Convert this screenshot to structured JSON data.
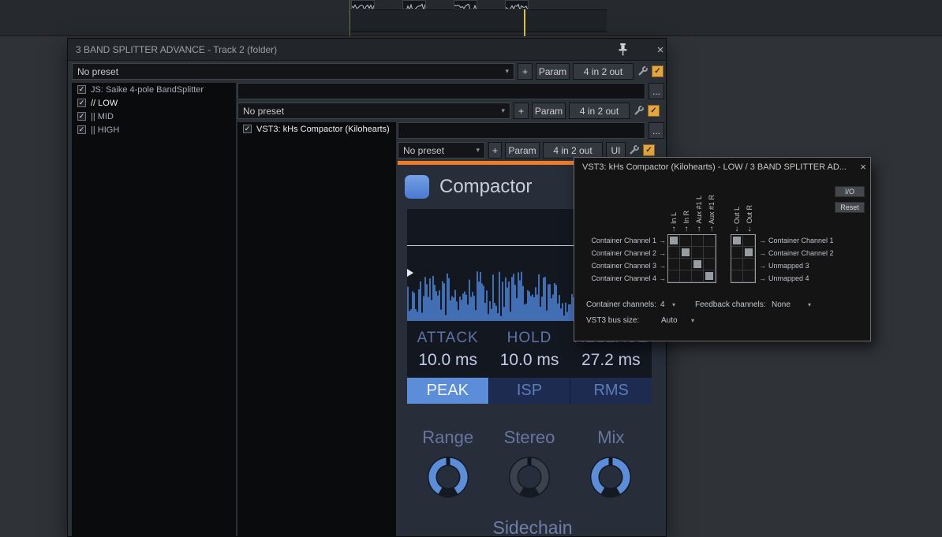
{
  "glyphs": {
    "check": "✓",
    "chevron": "▾",
    "more": "...",
    "close": "×",
    "in_arrow": "↑",
    "out_arrow": "↓",
    "row_arrow": "→"
  },
  "window": {
    "title": "3 BAND SPLITTER ADVANCE - Track 2 (folder)"
  },
  "chain": {
    "preset_label": "No preset",
    "add_label": "+",
    "param_label": "Param",
    "routing_label": "4 in 2 out",
    "items": [
      {
        "label": "JS: Saike 4-pole BandSplitter",
        "checked": true,
        "selected": false
      },
      {
        "label": "// LOW",
        "checked": true,
        "selected": true
      },
      {
        "label": "|| MID",
        "checked": true,
        "selected": false
      },
      {
        "label": "|| HIGH",
        "checked": true,
        "selected": false
      }
    ]
  },
  "container": {
    "name_value": "",
    "preset_label": "No preset",
    "add_label": "+",
    "param_label": "Param",
    "routing_label": "4 in 2 out",
    "items": [
      {
        "label": "VST3: kHs Compactor (Kilohearts)",
        "checked": true,
        "selected": true
      }
    ]
  },
  "fx": {
    "name_value": "",
    "preset_label": "No preset",
    "add_label": "+",
    "param_label": "Param",
    "routing_label": "4 in 2 out",
    "ui_label": "UI"
  },
  "plugin": {
    "title": "Compactor",
    "params": [
      {
        "label": "ATTACK",
        "value": "10.0 ms"
      },
      {
        "label": "HOLD",
        "value": "10.0 ms"
      },
      {
        "label": "RELEASE",
        "value": "27.2 ms"
      }
    ],
    "modes": [
      {
        "label": "PEAK",
        "active": true
      },
      {
        "label": "ISP",
        "active": false
      },
      {
        "label": "RMS",
        "active": false
      }
    ],
    "knobs": [
      {
        "label": "Range",
        "color": "#5b8dd9"
      },
      {
        "label": "Stereo",
        "color": "#3c424d"
      },
      {
        "label": "Mix",
        "color": "#5b8dd9"
      }
    ],
    "sidechain_label": "Sidechain",
    "accent_orange": "#f07b28",
    "accent_blue": "#5b8dd9"
  },
  "pins": {
    "title": "VST3: kHs Compactor (Kilohearts) - LOW / 3 BAND SPLITTER AD...",
    "io_label": "I/O",
    "reset_label": "Reset",
    "in_pins": [
      "In L",
      "In R",
      "Aux #1 L",
      "Aux #1 R"
    ],
    "out_pins": [
      "Out L",
      "Out R"
    ],
    "left_channels": [
      "Container Channel 1",
      "Container Channel 2",
      "Container Channel 3",
      "Container Channel 4"
    ],
    "right_channels": [
      "Container Channel 1",
      "Container Channel 2",
      "Unmapped 3",
      "Unmapped 4"
    ],
    "in_matrix": [
      [
        1,
        0,
        0,
        0
      ],
      [
        0,
        1,
        0,
        0
      ],
      [
        0,
        0,
        1,
        0
      ],
      [
        0,
        0,
        0,
        1
      ]
    ],
    "out_matrix": [
      [
        1,
        0
      ],
      [
        0,
        1
      ],
      [
        0,
        0
      ],
      [
        0,
        0
      ]
    ],
    "container_channels_label": "Container channels:",
    "container_channels_value": "4",
    "feedback_label": "Feedback channels:",
    "feedback_value": "None",
    "bus_label": "VST3 bus size:",
    "bus_value": "Auto"
  }
}
